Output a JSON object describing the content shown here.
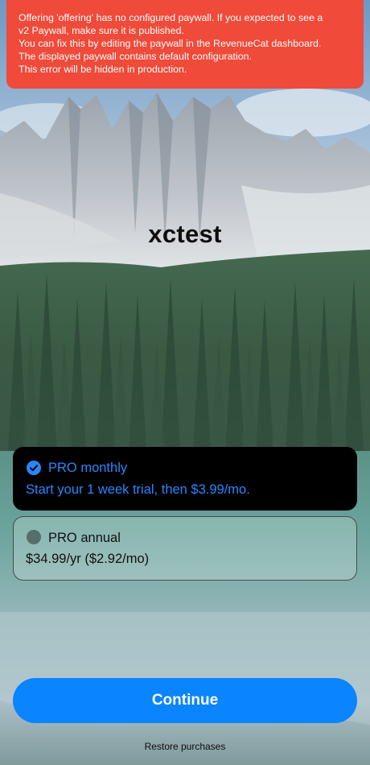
{
  "error_banner": {
    "lines": [
      "Offering 'offering' has no configured paywall. If you expected to see a",
      "v2 Paywall, make sure it is published.",
      "You can fix this by editing the paywall in the RevenueCat dashboard.",
      "The displayed paywall contains default configuration.",
      "This error will be hidden in production."
    ]
  },
  "header": {
    "title": "xctest"
  },
  "packages": [
    {
      "name": "PRO monthly",
      "description": "Start your 1 week trial, then $3.99/mo.",
      "selected": true
    },
    {
      "name": "PRO annual",
      "description": "$34.99/yr ($2.92/mo)",
      "selected": false
    }
  ],
  "footer": {
    "continue_label": "Continue",
    "restore_label": "Restore purchases"
  },
  "colors": {
    "accent": "#0a84ff",
    "error": "#ef4a3a",
    "selected_card": "#000000"
  },
  "icons": {
    "selected": "checkmark-circle-icon",
    "unselected": "radio-empty-icon"
  }
}
